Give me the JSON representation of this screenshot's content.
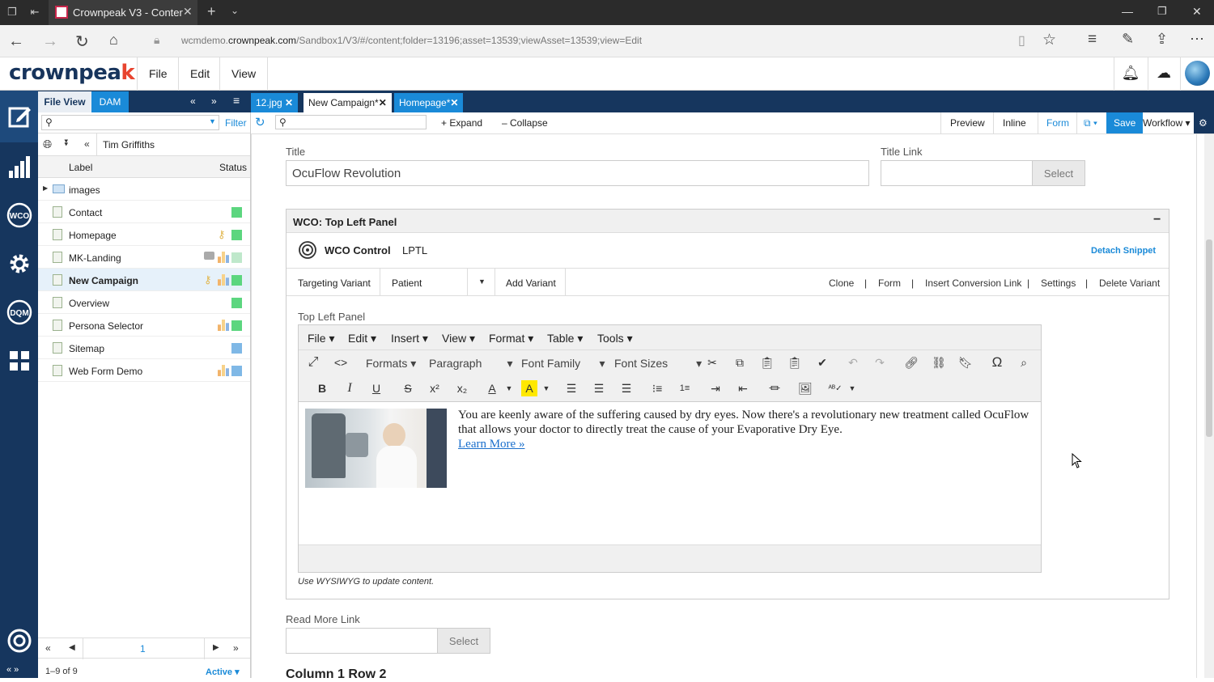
{
  "browser": {
    "tab_title": "Crownpeak V3 - Conter",
    "url_prefix": "wcmdemo.",
    "url_domain": "crownpeak.com",
    "url_path": "/Sandbox1/V3/#/content;folder=13196;asset=13539;viewAsset=13539;view=Edit"
  },
  "app": {
    "logo_main": "crownpea",
    "logo_k": "k",
    "menu": [
      "File",
      "Edit",
      "View"
    ]
  },
  "left_panel": {
    "tab_file_view": "File View",
    "tab_dam": "DAM",
    "filter_label": "Filter",
    "user": "Tim Griffiths",
    "col_label": "Label",
    "col_status": "Status",
    "items": [
      {
        "label": "images",
        "type": "folder",
        "status": []
      },
      {
        "label": "Contact",
        "type": "page",
        "status": [
          "green"
        ]
      },
      {
        "label": "Homepage",
        "type": "page",
        "status": [
          "key",
          "green"
        ]
      },
      {
        "label": "MK-Landing",
        "type": "page",
        "status": [
          "comment",
          "chart",
          "lightgreen"
        ]
      },
      {
        "label": "New Campaign",
        "type": "page",
        "status": [
          "key",
          "chart",
          "green"
        ],
        "selected": true
      },
      {
        "label": "Overview",
        "type": "page",
        "status": [
          "green"
        ]
      },
      {
        "label": "Persona Selector",
        "type": "page",
        "status": [
          "chart",
          "green"
        ]
      },
      {
        "label": "Sitemap",
        "type": "page",
        "status": [
          "blue"
        ]
      },
      {
        "label": "Web Form Demo",
        "type": "page",
        "status": [
          "chart",
          "blue"
        ]
      }
    ],
    "page_number": "1",
    "count_text": "1–9 of 9",
    "active_label": "Active"
  },
  "doc_tabs": [
    {
      "label": "12.jpg",
      "active": false
    },
    {
      "label": "New Campaign*",
      "active": true
    },
    {
      "label": "Homepage*",
      "active": false
    }
  ],
  "toolbar": {
    "expand": "+ Expand",
    "collapse": "– Collapse",
    "preview": "Preview",
    "inline": "Inline",
    "form": "Form",
    "save": "Save",
    "workflow": "Workflow"
  },
  "form": {
    "title_label": "Title",
    "title_value": "OcuFlow Revolution",
    "title_link_label": "Title Link",
    "select_label": "Select",
    "panel_title": "WCO: Top Left Panel",
    "wco_control": "WCO Control",
    "wco_id": "LPTL",
    "detach_snippet": "Detach Snippet",
    "targeting_variant": "Targeting Variant",
    "variant_value": "Patient",
    "add_variant": "Add Variant",
    "actions": [
      "Clone",
      "Form",
      "Insert Conversion Link",
      "Settings",
      "Delete Variant"
    ],
    "editor_label": "Top Left Panel",
    "editor_menu": [
      "File",
      "Edit",
      "Insert",
      "View",
      "Format",
      "Table",
      "Tools"
    ],
    "formats": "Formats",
    "paragraph": "Paragraph",
    "font_family": "Font Family",
    "font_sizes": "Font Sizes",
    "body_text": "You are keenly aware of the suffering caused by dry eyes. Now there's a revolutionary new treatment called OcuFlow that allows your doctor to directly treat the cause of your Evaporative Dry Eye.",
    "learn_more": "Learn More »",
    "hint": "Use WYSIWYG to update content.",
    "read_more_label": "Read More Link",
    "next_heading": "Column 1 Row 2"
  },
  "colors": {
    "navy": "#16365e",
    "accent_blue": "#1a8ad8",
    "status_green": "#5cd67f",
    "status_blue": "#7fb8e6"
  }
}
